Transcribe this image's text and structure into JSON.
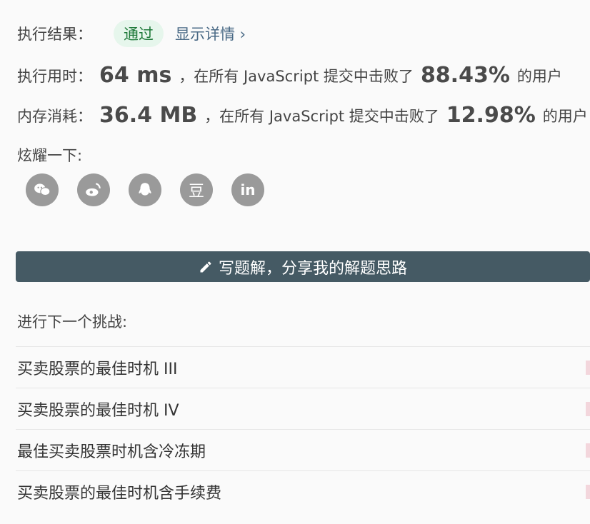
{
  "result": {
    "label": "执行结果：",
    "status": "通过",
    "details_link": "显示详情 ›"
  },
  "runtime": {
    "label": "执行用时：",
    "value": "64 ms",
    "middle": "，在所有 JavaScript 提交中击败了",
    "percent": "88.43%",
    "suffix": "的用户"
  },
  "memory": {
    "label": "内存消耗：",
    "value": "36.4 MB",
    "middle": "，在所有 JavaScript 提交中击败了",
    "percent": "12.98%",
    "suffix": "的用户"
  },
  "share": {
    "label": "炫耀一下:",
    "icons": [
      "wechat-icon",
      "weibo-icon",
      "qq-icon",
      "douban-icon",
      "linkedin-icon"
    ],
    "douban_glyph": "豆",
    "linkedin_glyph": "in"
  },
  "write_solution": {
    "label": "写题解，分享我的解题思路",
    "icon": "pencil-icon"
  },
  "next_challenge": {
    "label": "进行下一个挑战:",
    "items": [
      "买卖股票的最佳时机 III",
      "买卖股票的最佳时机 IV",
      "最佳买卖股票时机含冷冻期",
      "买卖股票的最佳时机含手续费"
    ]
  },
  "colors": {
    "badge_bg": "#e6f6ec",
    "badge_text": "#1f7a3a",
    "button_bg": "#455a64",
    "icon_bg": "#9a9a9a"
  }
}
